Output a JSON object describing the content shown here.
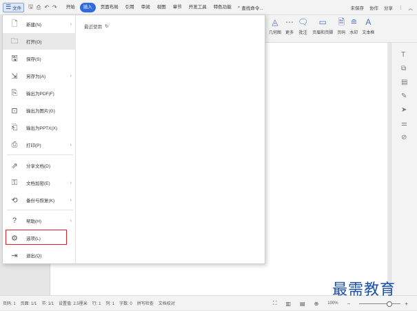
{
  "topbar": {
    "file_label": "文件",
    "tabs": [
      "开始",
      "插入",
      "页面布局",
      "引用",
      "审阅",
      "视图",
      "章节",
      "开发工具",
      "特色功能"
    ],
    "active_tab": "插入",
    "search_label": "查找命令...",
    "unsaved": "未保存",
    "collab": "协作",
    "share": "分享"
  },
  "ribbon": {
    "items": [
      "几何图",
      "更多",
      "批注",
      "页眉和页脚",
      "页码",
      "水印",
      "文本框"
    ]
  },
  "menu": {
    "items": [
      {
        "label": "新建(N)",
        "icon": "new-doc-icon",
        "arrow": true
      },
      {
        "label": "打开(O)",
        "icon": "folder-icon",
        "arrow": false
      },
      {
        "label": "保存(S)",
        "icon": "save-icon",
        "arrow": false
      },
      {
        "label": "另存为(A)",
        "icon": "save-as-icon",
        "arrow": true
      },
      {
        "label": "输出为PDF(F)",
        "icon": "pdf-icon",
        "arrow": false
      },
      {
        "label": "输出为图片(G)",
        "icon": "image-icon",
        "arrow": false
      },
      {
        "label": "输出为PPTX(X)",
        "icon": "pptx-icon",
        "arrow": false
      },
      {
        "label": "打印(P)",
        "icon": "print-icon",
        "arrow": true
      },
      {
        "label": "分享文档(D)",
        "icon": "share-icon",
        "arrow": false
      },
      {
        "label": "文档加密(E)",
        "icon": "encrypt-icon",
        "arrow": true
      },
      {
        "label": "备份与恢复(K)",
        "icon": "backup-icon",
        "arrow": true
      },
      {
        "label": "帮助(H)",
        "icon": "help-icon",
        "arrow": true
      },
      {
        "label": "选项(L)",
        "icon": "settings-icon",
        "arrow": false
      },
      {
        "label": "退出(Q)",
        "icon": "exit-icon",
        "arrow": false
      }
    ],
    "recent_label": "最近使用"
  },
  "statusbar": {
    "page": "页码: 1",
    "pages": "页面: 1/1",
    "section": "节: 1/1",
    "setting": "设置值: 2.5厘米",
    "row": "行: 1",
    "col": "列: 1",
    "words": "字数: 0",
    "spell": "拼写检查",
    "proof": "文档校对",
    "zoom": "100%"
  },
  "watermark": "最需教育",
  "colors": {
    "accent": "#2f6be0",
    "highlight_box": "#e02020"
  }
}
